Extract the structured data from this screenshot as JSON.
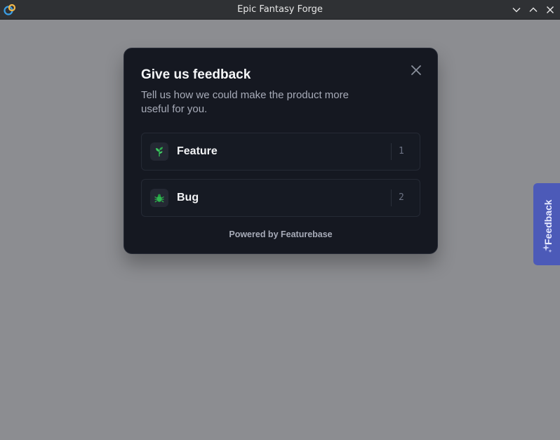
{
  "window": {
    "title": "Epic Fantasy Forge",
    "icons": {
      "app": "app-logo-icon",
      "minimize": "chevron-down-icon",
      "maximize": "chevron-up-icon",
      "close": "close-icon"
    }
  },
  "modal": {
    "title": "Give us feedback",
    "subtitle": "Tell us how we could make the product more useful for you.",
    "close_icon": "close-icon",
    "options": [
      {
        "label": "Feature",
        "key": "1",
        "icon": "plant-icon"
      },
      {
        "label": "Bug",
        "key": "2",
        "icon": "bug-icon"
      }
    ],
    "powered_by": "Powered by Featurebase"
  },
  "feedback_tab": {
    "label": "Feedback",
    "icon": "sparkle-icon"
  },
  "colors": {
    "backdrop": "#8c8d91",
    "modal_bg": "#151821",
    "accent_tab": "#4c5ab8",
    "titlebar": "#2f3134"
  }
}
